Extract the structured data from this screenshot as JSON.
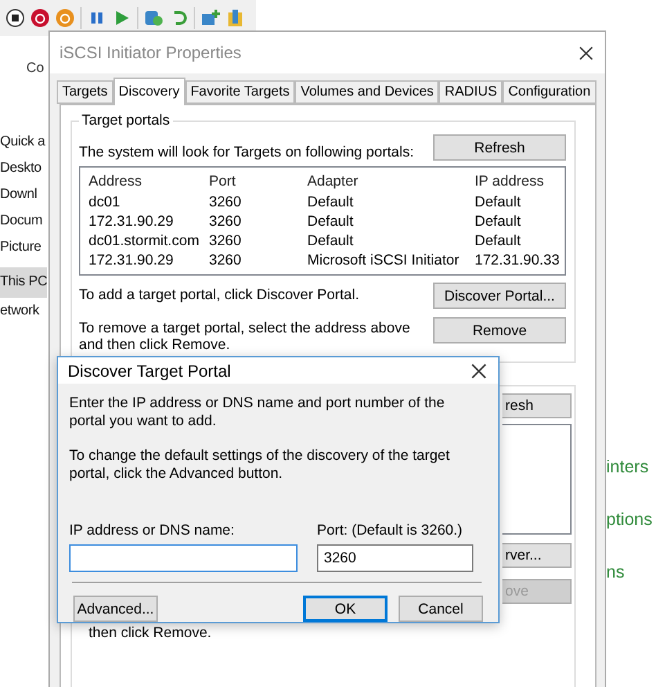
{
  "explorer": {
    "ribbon_tab": "Co",
    "nav_items": [
      {
        "label": "Quick a",
        "selected": false
      },
      {
        "label": "Deskto",
        "selected": false
      },
      {
        "label": "Downl",
        "selected": false
      },
      {
        "label": "Docum",
        "selected": false
      },
      {
        "label": "Picture",
        "selected": false
      },
      {
        "label": "This PC",
        "selected": true
      },
      {
        "label": "etwork",
        "selected": false
      }
    ]
  },
  "side_links": [
    "inters",
    "ptions",
    "ns"
  ],
  "properties_dialog": {
    "title": "iSCSI Initiator Properties",
    "tabs": [
      {
        "label": "Targets",
        "selected": false
      },
      {
        "label": "Discovery",
        "selected": true
      },
      {
        "label": "Favorite Targets",
        "selected": false
      },
      {
        "label": "Volumes and Devices",
        "selected": false
      },
      {
        "label": "RADIUS",
        "selected": false
      },
      {
        "label": "Configuration",
        "selected": false
      }
    ],
    "target_portals": {
      "title": "Target portals",
      "description": "The system will look for Targets on following portals:",
      "refresh_button": "Refresh",
      "columns": [
        "Address",
        "Port",
        "Adapter",
        "IP address"
      ],
      "rows": [
        [
          "dc01",
          "3260",
          "Default",
          "Default"
        ],
        [
          "172.31.90.29",
          "3260",
          "Default",
          "Default"
        ],
        [
          "dc01.stormit.com",
          "3260",
          "Default",
          "Default"
        ],
        [
          "172.31.90.29",
          "3260",
          "Microsoft iSCSI Initiator",
          "172.31.90.33"
        ]
      ],
      "add_hint": "To add a target portal, click Discover Portal.",
      "discover_button": "Discover Portal...",
      "remove_hint": "To remove a target portal, select the address above and then click Remove.",
      "remove_button": "Remove"
    },
    "lower_group": {
      "buttons": [
        {
          "label": "resh",
          "disabled": false
        },
        {
          "label": "rver...",
          "disabled": false
        },
        {
          "label": "ove",
          "disabled": true
        }
      ],
      "hint": "then click Remove."
    }
  },
  "discover_dialog": {
    "title": "Discover Target Portal",
    "intro": "Enter the IP address or DNS name and port number of the portal you want to add.",
    "advanced_hint": "To change the default settings of the discovery of the target portal, click the Advanced button.",
    "ip_label": "IP address or DNS name:",
    "port_label": "Port: (Default is 3260.)",
    "port_value": "3260",
    "buttons": [
      {
        "label": "Advanced...",
        "default": false
      },
      {
        "label": "OK",
        "default": true
      },
      {
        "label": "Cancel",
        "default": false
      }
    ]
  }
}
